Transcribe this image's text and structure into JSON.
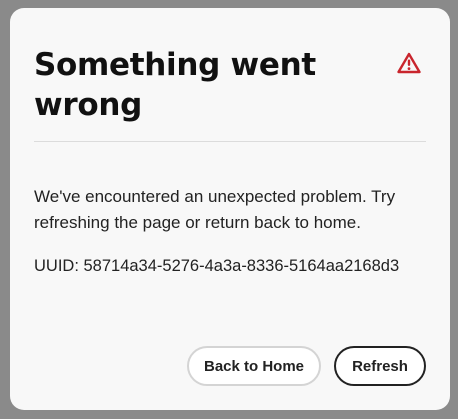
{
  "dialog": {
    "title": "Something went wrong",
    "alert_icon": "alert-triangle-icon",
    "alert_color": "#c9252d",
    "message": "We've encountered an unexpected problem. Try refreshing the page or return back to home.",
    "uuid_label": "UUID: 58714a34-5276-4a3a-8336-5164aa2168d3",
    "buttons": {
      "back_home": "Back to Home",
      "refresh": "Refresh"
    }
  }
}
